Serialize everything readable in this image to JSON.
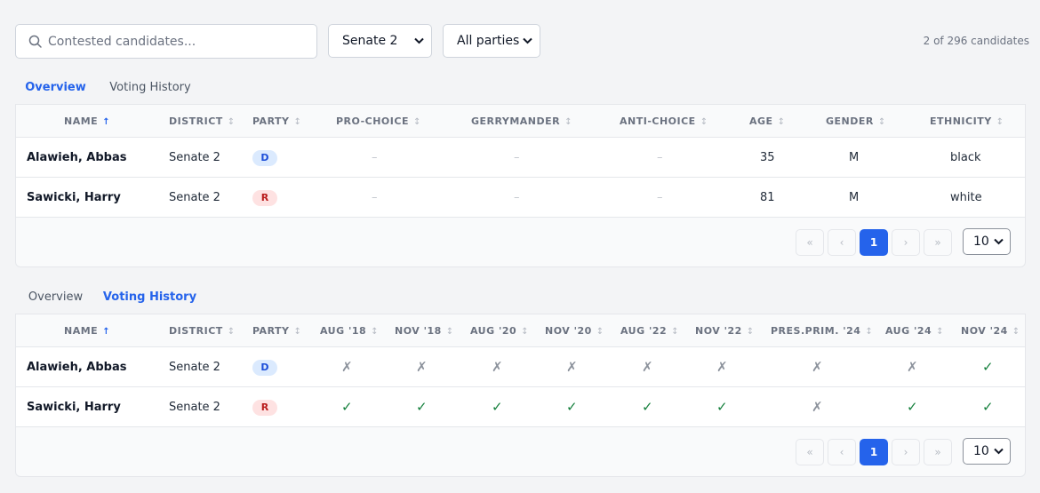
{
  "search": {
    "placeholder": "Contested candidates..."
  },
  "filters": {
    "district": "Senate 2",
    "party": "All parties"
  },
  "count_text": "2 of 296 candidates",
  "overview": {
    "tabs": [
      "Overview",
      "Voting History"
    ],
    "headers": [
      "NAME",
      "DISTRICT",
      "PARTY",
      "PRO-CHOICE",
      "GERRYMANDER",
      "ANTI-CHOICE",
      "AGE",
      "GENDER",
      "ETHNICITY"
    ],
    "rows": [
      {
        "name": "Alawieh, Abbas",
        "district": "Senate 2",
        "party": "D",
        "pro_choice": "–",
        "gerrymander": "–",
        "anti_choice": "–",
        "age": "35",
        "gender": "M",
        "ethnicity": "black"
      },
      {
        "name": "Sawicki, Harry",
        "district": "Senate 2",
        "party": "R",
        "pro_choice": "–",
        "gerrymander": "–",
        "anti_choice": "–",
        "age": "81",
        "gender": "M",
        "ethnicity": "white"
      }
    ]
  },
  "voting": {
    "tabs": [
      "Overview",
      "Voting History"
    ],
    "headers": [
      "NAME",
      "DISTRICT",
      "PARTY",
      "AUG '18",
      "NOV '18",
      "AUG '20",
      "NOV '20",
      "AUG '22",
      "NOV '22",
      "PRES.PRIM. '24",
      "AUG '24",
      "NOV '24"
    ],
    "rows": [
      {
        "name": "Alawieh, Abbas",
        "district": "Senate 2",
        "party": "D",
        "votes": [
          "✗",
          "✗",
          "✗",
          "✗",
          "✗",
          "✗",
          "✗",
          "✗",
          "✓"
        ]
      },
      {
        "name": "Sawicki, Harry",
        "district": "Senate 2",
        "party": "R",
        "votes": [
          "✓",
          "✓",
          "✓",
          "✓",
          "✓",
          "✓",
          "✗",
          "✓",
          "✓"
        ]
      }
    ]
  },
  "pagination": {
    "first": "«",
    "prev": "‹",
    "page": "1",
    "next": "›",
    "last": "»",
    "page_size": "10"
  },
  "colors": {
    "accent": "#2563eb",
    "dem_bg": "#dbeafe",
    "rep_bg": "#fee2e2",
    "check": "#15803d",
    "cross": "#8b919b"
  }
}
